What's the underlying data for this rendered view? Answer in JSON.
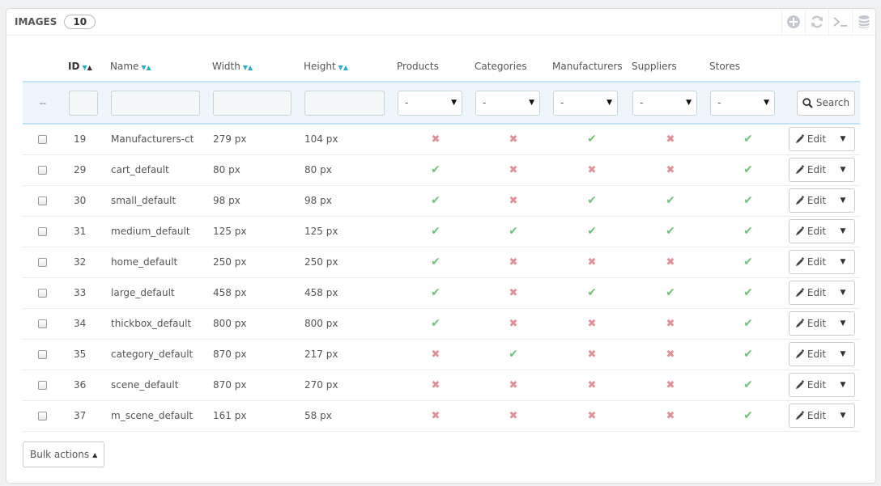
{
  "header": {
    "title": "IMAGES",
    "count": "10"
  },
  "toolbar": [
    "add-icon",
    "refresh-icon",
    "sql-query-icon",
    "export-database-icon"
  ],
  "columns": {
    "id": "ID",
    "name": "Name",
    "width": "Width",
    "height": "Height",
    "products": "Products",
    "categories": "Categories",
    "manufacturers": "Manufacturers",
    "suppliers": "Suppliers",
    "stores": "Stores"
  },
  "filters": {
    "dash": "--",
    "select_value": "-",
    "search_label": "Search"
  },
  "rows": [
    {
      "id": "19",
      "name": "Manufacturers-ct",
      "width": "279 px",
      "height": "104 px",
      "products": false,
      "categories": false,
      "manufacturers": true,
      "suppliers": false,
      "stores": true
    },
    {
      "id": "29",
      "name": "cart_default",
      "width": "80 px",
      "height": "80 px",
      "products": true,
      "categories": false,
      "manufacturers": false,
      "suppliers": false,
      "stores": true
    },
    {
      "id": "30",
      "name": "small_default",
      "width": "98 px",
      "height": "98 px",
      "products": true,
      "categories": false,
      "manufacturers": true,
      "suppliers": true,
      "stores": true
    },
    {
      "id": "31",
      "name": "medium_default",
      "width": "125 px",
      "height": "125 px",
      "products": true,
      "categories": true,
      "manufacturers": true,
      "suppliers": true,
      "stores": true
    },
    {
      "id": "32",
      "name": "home_default",
      "width": "250 px",
      "height": "250 px",
      "products": true,
      "categories": false,
      "manufacturers": false,
      "suppliers": false,
      "stores": true
    },
    {
      "id": "33",
      "name": "large_default",
      "width": "458 px",
      "height": "458 px",
      "products": true,
      "categories": false,
      "manufacturers": true,
      "suppliers": true,
      "stores": true
    },
    {
      "id": "34",
      "name": "thickbox_default",
      "width": "800 px",
      "height": "800 px",
      "products": true,
      "categories": false,
      "manufacturers": false,
      "suppliers": false,
      "stores": true
    },
    {
      "id": "35",
      "name": "category_default",
      "width": "870 px",
      "height": "217 px",
      "products": false,
      "categories": true,
      "manufacturers": false,
      "suppliers": false,
      "stores": true
    },
    {
      "id": "36",
      "name": "scene_default",
      "width": "870 px",
      "height": "270 px",
      "products": false,
      "categories": false,
      "manufacturers": false,
      "suppliers": false,
      "stores": true
    },
    {
      "id": "37",
      "name": "m_scene_default",
      "width": "161 px",
      "height": "58 px",
      "products": false,
      "categories": false,
      "manufacturers": false,
      "suppliers": false,
      "stores": true
    }
  ],
  "row_action": {
    "edit_label": "Edit"
  },
  "footer": {
    "bulk_label": "Bulk actions"
  },
  "colors": {
    "enabled": "#72c279",
    "disabled": "#e08f95",
    "accent": "#2eacce",
    "filter_bg": "#eef5fb"
  }
}
